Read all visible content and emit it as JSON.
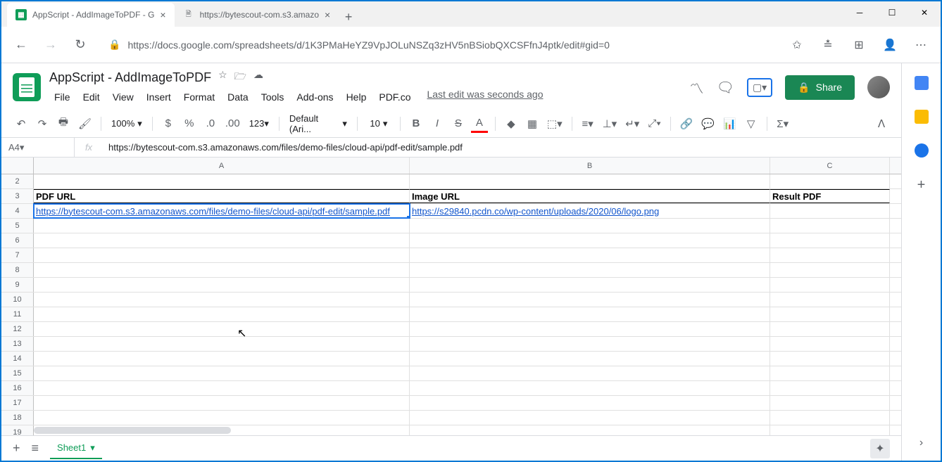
{
  "browser": {
    "tabs": [
      {
        "title": "AppScript - AddImageToPDF - G",
        "active": true,
        "favicon": "sheets"
      },
      {
        "title": "https://bytescout-com.s3.amazo",
        "active": false,
        "favicon": "page"
      }
    ],
    "url": "https://docs.google.com/spreadsheets/d/1K3PMaHeYZ9VpJOLuNSZq3zHV5nBSiobQXCSFfnJ4ptk/edit#gid=0"
  },
  "doc": {
    "title": "AppScript - AddImageToPDF",
    "menus": [
      "File",
      "Edit",
      "View",
      "Insert",
      "Format",
      "Data",
      "Tools",
      "Add-ons",
      "Help",
      "PDF.co"
    ],
    "last_edit": "Last edit was seconds ago",
    "share_label": "Share"
  },
  "toolbar": {
    "zoom": "100%",
    "font": "Default (Ari...",
    "font_size": "10"
  },
  "formula": {
    "name_box": "A4",
    "value": "https://bytescout-com.s3.amazonaws.com/files/demo-files/cloud-api/pdf-edit/sample.pdf"
  },
  "grid": {
    "col_headers": [
      "A",
      "B",
      "C"
    ],
    "rows": [
      {
        "num": 2,
        "cells": [
          "",
          "",
          ""
        ]
      },
      {
        "num": 3,
        "cells": [
          "PDF URL",
          "Image URL",
          "Result PDF"
        ],
        "header": true
      },
      {
        "num": 4,
        "cells": [
          "https://bytescout-com.s3.amazonaws.com/files/demo-files/cloud-api/pdf-edit/sample.pdf",
          "https://s29840.pcdn.co/wp-content/uploads/2020/06/logo.png",
          ""
        ],
        "links": [
          true,
          true,
          false
        ],
        "selected_col": 0
      },
      {
        "num": 5,
        "cells": [
          "",
          "",
          ""
        ]
      },
      {
        "num": 6,
        "cells": [
          "",
          "",
          ""
        ]
      },
      {
        "num": 7,
        "cells": [
          "",
          "",
          ""
        ]
      },
      {
        "num": 8,
        "cells": [
          "",
          "",
          ""
        ]
      },
      {
        "num": 9,
        "cells": [
          "",
          "",
          ""
        ]
      },
      {
        "num": 10,
        "cells": [
          "",
          "",
          ""
        ]
      },
      {
        "num": 11,
        "cells": [
          "",
          "",
          ""
        ]
      },
      {
        "num": 12,
        "cells": [
          "",
          "",
          ""
        ]
      },
      {
        "num": 13,
        "cells": [
          "",
          "",
          ""
        ]
      },
      {
        "num": 14,
        "cells": [
          "",
          "",
          ""
        ]
      },
      {
        "num": 15,
        "cells": [
          "",
          "",
          ""
        ]
      },
      {
        "num": 16,
        "cells": [
          "",
          "",
          ""
        ]
      },
      {
        "num": 17,
        "cells": [
          "",
          "",
          ""
        ]
      },
      {
        "num": 18,
        "cells": [
          "",
          "",
          ""
        ]
      },
      {
        "num": 19,
        "cells": [
          "",
          "",
          ""
        ]
      }
    ]
  },
  "sheet_tabs": {
    "active": "Sheet1"
  }
}
